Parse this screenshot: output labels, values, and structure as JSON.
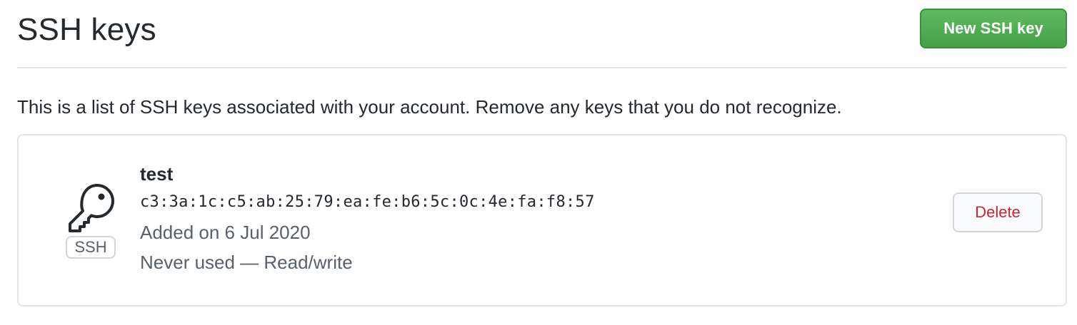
{
  "header": {
    "title": "SSH keys",
    "new_key_label": "New SSH key"
  },
  "description": "This is a list of SSH keys associated with your account. Remove any keys that you do not recognize.",
  "keys": [
    {
      "icon": "key-icon",
      "badge": "SSH",
      "title": "test",
      "fingerprint": "c3:3a:1c:c5:ab:25:79:ea:fe:b6:5c:0c:4e:fa:f8:57",
      "added": "Added on 6 Jul 2020",
      "usage": "Never used — Read/write",
      "delete_label": "Delete"
    }
  ],
  "colors": {
    "primary_button": "#44a148",
    "danger_text": "#cb2431",
    "muted_text": "#586069",
    "border": "#e1e4e8"
  }
}
